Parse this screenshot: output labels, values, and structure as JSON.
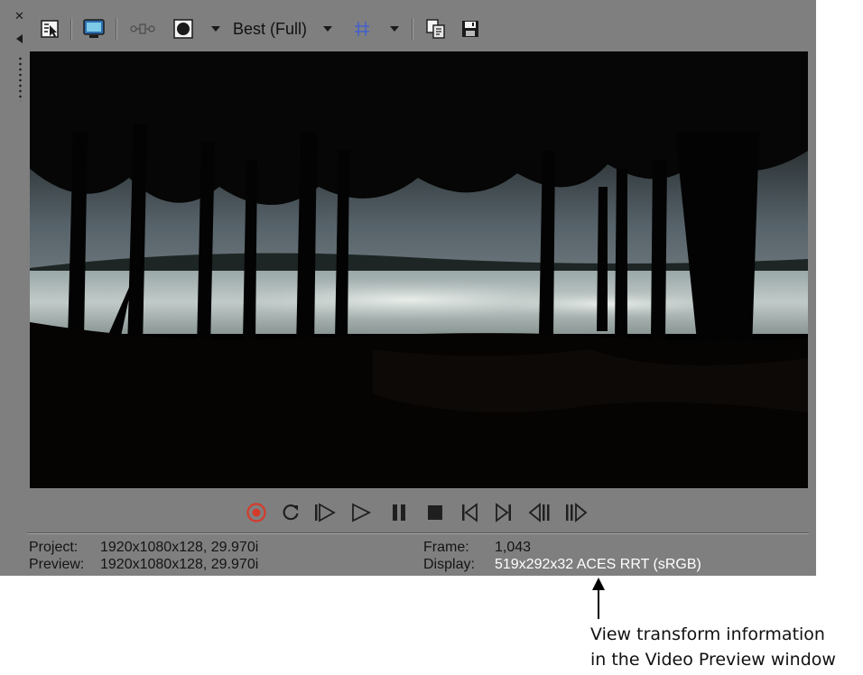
{
  "toolbar": {
    "icons": [
      "properties-icon",
      "monitor-icon",
      "split-screen-icon",
      "adjust-size-icon",
      "quality-dropdown",
      "overlays-icon",
      "copy-snapshot-icon",
      "save-snapshot-icon"
    ],
    "quality_label": "Best (Full)"
  },
  "transport": {
    "icons": [
      "record-icon",
      "loop-icon",
      "play-from-start-icon",
      "play-icon",
      "pause-icon",
      "stop-icon",
      "go-to-start-icon",
      "go-to-end-icon",
      "previous-frame-icon",
      "next-frame-icon"
    ]
  },
  "status": {
    "project_label": "Project:",
    "project_value": "1920x1080x128, 29.970i",
    "preview_label": "Preview:",
    "preview_value": "1920x1080x128, 29.970i",
    "frame_label": "Frame:",
    "frame_value": "1,043",
    "display_label": "Display:",
    "display_value": "519x292x32 ACES RRT (sRGB)"
  },
  "annotation": {
    "line1": "View transform information",
    "line2": "in the Video Preview window"
  },
  "colors": {
    "panel_bg": "#7f7f7f",
    "highlight_text": "#ffffff",
    "record_red": "#d63a2a"
  }
}
